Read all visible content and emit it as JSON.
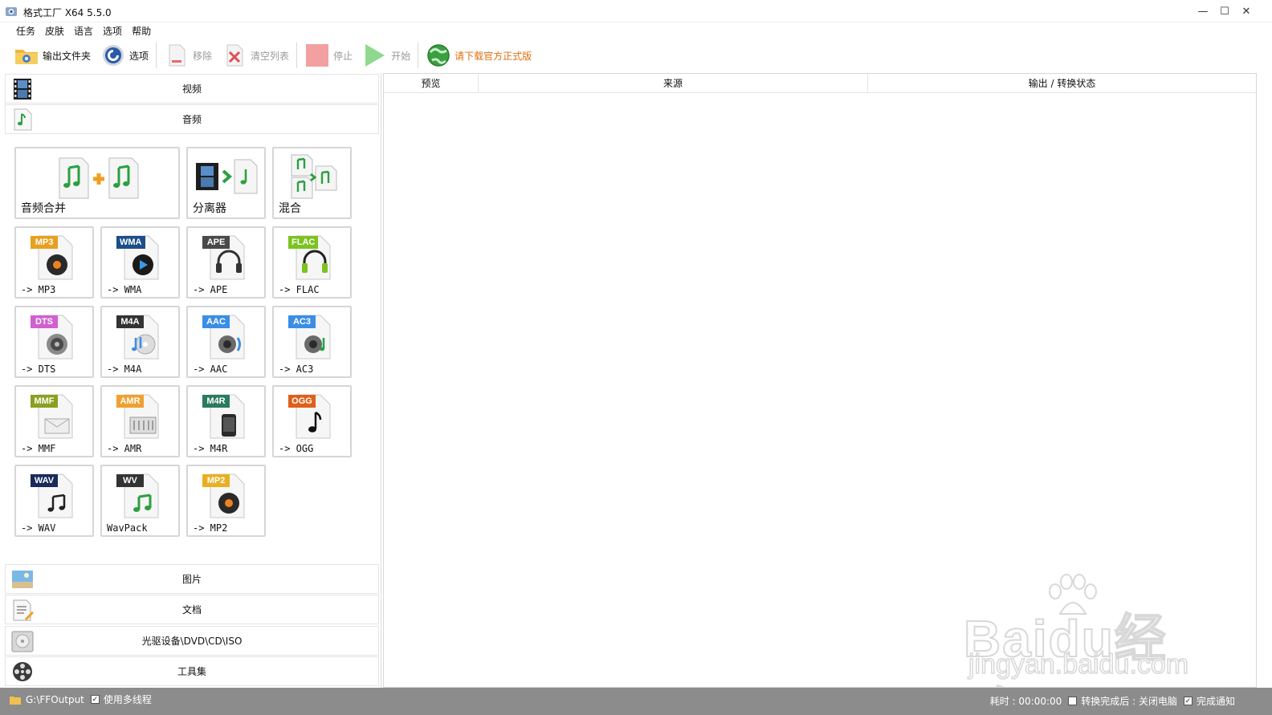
{
  "window": {
    "title": "格式工厂 X64 5.5.0",
    "min_glyph": "—",
    "max_glyph": "☐",
    "close_glyph": "✕"
  },
  "menu": [
    "任务",
    "皮肤",
    "语言",
    "选项",
    "帮助"
  ],
  "toolbar": {
    "output_folder": "输出文件夹",
    "options": "选项",
    "remove": "移除",
    "clear_list": "清空列表",
    "stop": "停止",
    "start": "开始",
    "download_official": "请下载官方正式版"
  },
  "categories": {
    "video": "视频",
    "audio": "音频",
    "picture": "图片",
    "document": "文档",
    "optical": "光驱设备\\DVD\\CD\\ISO",
    "tools": "工具集"
  },
  "audio_tools": {
    "merge": "音频合并",
    "splitter": "分离器",
    "mix": "混合"
  },
  "formats": [
    {
      "badge": "MP3",
      "label": "-> MP3",
      "color": "#e8a020"
    },
    {
      "badge": "WMA",
      "label": "-> WMA",
      "color": "#1c4e8a"
    },
    {
      "badge": "APE",
      "label": "-> APE",
      "color": "#4a4a4a"
    },
    {
      "badge": "FLAC",
      "label": "-> FLAC",
      "color": "#7cc320"
    },
    {
      "badge": "DTS",
      "label": "-> DTS",
      "color": "#d060d0"
    },
    {
      "badge": "M4A",
      "label": "-> M4A",
      "color": "#333333"
    },
    {
      "badge": "AAC",
      "label": "-> AAC",
      "color": "#3a8ee6"
    },
    {
      "badge": "AC3",
      "label": "-> AC3",
      "color": "#3a8ee6"
    },
    {
      "badge": "MMF",
      "label": "-> MMF",
      "color": "#8aa020"
    },
    {
      "badge": "AMR",
      "label": "-> AMR",
      "color": "#f0a030"
    },
    {
      "badge": "M4R",
      "label": "-> M4R",
      "color": "#2a7a60"
    },
    {
      "badge": "OGG",
      "label": "-> OGG",
      "color": "#e0601a"
    },
    {
      "badge": "WAV",
      "label": "-> WAV",
      "color": "#1a2a5a"
    },
    {
      "badge": "WV",
      "label": "WavPack",
      "color": "#333333"
    },
    {
      "badge": "MP2",
      "label": "-> MP2",
      "color": "#e8b020"
    }
  ],
  "table": {
    "col_preview": "预览",
    "col_source": "来源",
    "col_status": "输出 / 转换状态"
  },
  "status": {
    "output_path": "G:\\FFOutput",
    "multithread": "使用多线程",
    "elapsed": "耗时 : 00:00:00",
    "after_convert": "转换完成后 : 关闭电脑",
    "notify": "完成通知"
  }
}
